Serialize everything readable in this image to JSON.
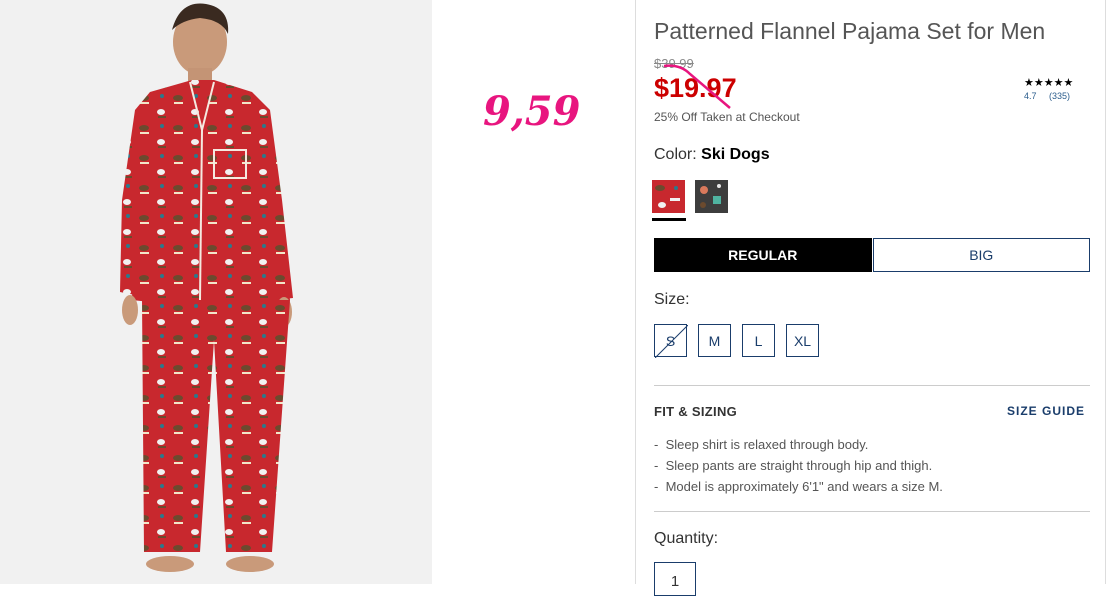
{
  "product": {
    "title": "Patterned Flannel Pajama Set for Men",
    "original_price": "$39.99",
    "sale_price": "$19.97",
    "discount_note": "25% Off Taken at Checkout",
    "handwritten_annotation": "9,59",
    "rating": {
      "stars": "★★★★★",
      "score": "4.7",
      "count": "(335)"
    },
    "color": {
      "label": "Color:",
      "selected": "Ski Dogs",
      "swatches": [
        "Ski Dogs (red)",
        "dark print"
      ]
    },
    "fit_tabs": [
      "REGULAR",
      "BIG"
    ],
    "selected_fit": "REGULAR",
    "size": {
      "label": "Size:",
      "options": [
        "S",
        "M",
        "L",
        "XL"
      ],
      "unavailable": [
        "S"
      ]
    },
    "fit_sizing": {
      "heading": "FIT & SIZING",
      "guide_link": "SIZE GUIDE",
      "bullets": [
        "Sleep shirt is relaxed through body.",
        "Sleep pants are straight through hip and thigh.",
        "Model is approximately 6'1\" and wears a size M."
      ]
    },
    "quantity": {
      "label": "Quantity:",
      "value": "1"
    }
  },
  "colors": {
    "sale_red": "#cc0000",
    "annotation_pink": "#e8157f",
    "link_navy": "#1a3d6b",
    "pajama_red": "#c8282e"
  }
}
